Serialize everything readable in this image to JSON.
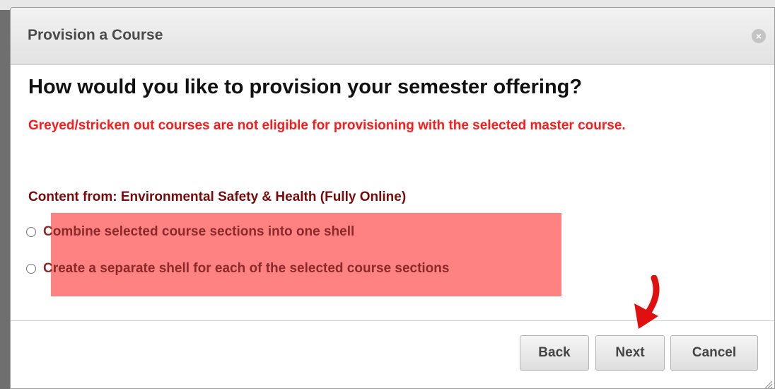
{
  "dialog": {
    "title": "Provision a Course",
    "question": "How would you like to provision your semester offering?",
    "warning": "Greyed/stricken out courses are not eligible for provisioning with the selected master course.",
    "content_from": "Content from: Environmental Safety & Health (Fully Online)",
    "options": [
      {
        "label": "Combine selected course sections into one shell",
        "selected": false
      },
      {
        "label": "Create a separate shell for each of the selected course sections",
        "selected": false
      }
    ],
    "buttons": {
      "back": "Back",
      "next": "Next",
      "cancel": "Cancel"
    }
  },
  "colors": {
    "warning": "#ff1a1a",
    "content_from": "#7a0a0a",
    "highlight": "#ff8282",
    "annotation_arrow": "#e01010"
  },
  "icons": {
    "close": "close-icon",
    "arrow": "red-arrow-annotation",
    "resize": "resize-grip-icon"
  }
}
